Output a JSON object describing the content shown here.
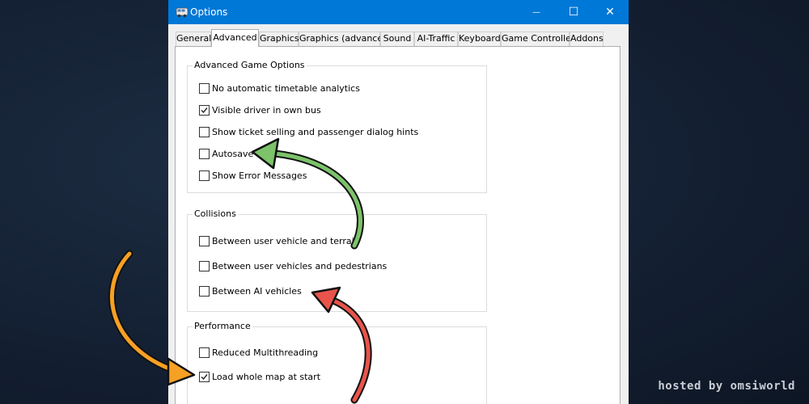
{
  "window": {
    "title": "Options",
    "controls": {
      "minimize": "—",
      "maximize": "☐",
      "close": "✕"
    }
  },
  "tabs": [
    {
      "label": "General",
      "active": false
    },
    {
      "label": "Advanced",
      "active": true
    },
    {
      "label": "Graphics",
      "active": false
    },
    {
      "label": "Graphics (advanced)",
      "active": false
    },
    {
      "label": "Sound",
      "active": false
    },
    {
      "label": "AI-Traffic",
      "active": false
    },
    {
      "label": "Keyboard",
      "active": false
    },
    {
      "label": "Game Controller",
      "active": false
    },
    {
      "label": "Addons",
      "active": false
    }
  ],
  "groups": {
    "advanced": {
      "title": "Advanced Game Options",
      "options": [
        {
          "label": "No automatic timetable analytics",
          "checked": false
        },
        {
          "label": "Visible driver in own bus",
          "checked": true
        },
        {
          "label": "Show ticket selling and passenger dialog hints",
          "checked": false
        },
        {
          "label": "Autosave",
          "checked": false
        },
        {
          "label": "Show Error Messages",
          "checked": false
        }
      ]
    },
    "collisions": {
      "title": "Collisions",
      "options": [
        {
          "label": "Between user vehicle and terrain",
          "checked": false
        },
        {
          "label": "Between user vehicles and pedestrians",
          "checked": false
        },
        {
          "label": "Between AI vehicles",
          "checked": false
        }
      ]
    },
    "performance": {
      "title": "Performance",
      "options": [
        {
          "label": "Reduced Multithreading",
          "checked": false
        },
        {
          "label": "Load whole map at start",
          "checked": true
        }
      ]
    }
  },
  "annotations": {
    "arrow_colors": {
      "green": "#7cc36a",
      "red": "#e8544b",
      "orange": "#f6a024"
    }
  },
  "watermark": "hosted by omsiworld"
}
